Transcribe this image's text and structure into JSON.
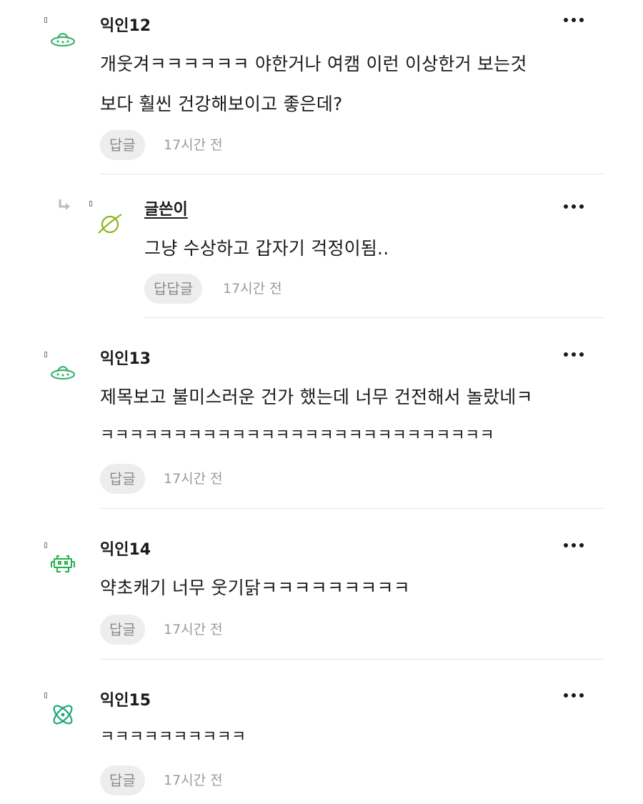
{
  "comments": [
    {
      "author": "익인12",
      "lines": [
        "개웃겨ㅋㅋㅋㅋㅋㅋ 야한거나 여캠 이런 이상한거 보는것",
        "보다 훨씬 건강해보이고 좋은데?"
      ],
      "reply_label": "답글",
      "time": "17시간 전",
      "avatar_icon": "ufo-icon",
      "avatar_color": "#3cb371"
    },
    {
      "author": "글쓴이",
      "lines": [
        "그냥 수상하고 갑자기 걱정이됨.."
      ],
      "reply_label": "답답글",
      "time": "17시간 전",
      "avatar_icon": "planet-icon",
      "avatar_color": "#8bb31d",
      "is_reply": true
    },
    {
      "author": "익인13",
      "lines": [
        "제목보고 불미스러운 건가 했는데 너무 건전해서 놀랐네ㅋ",
        "ㅋㅋㅋㅋㅋㅋㅋㅋㅋㅋㅋㅋㅋㅋㅋㅋㅋㅋㅋㅋㅋㅋㅋㅋㅋㅋㅋ"
      ],
      "reply_label": "답글",
      "time": "17시간 전",
      "avatar_icon": "ufo-icon",
      "avatar_color": "#3cb371"
    },
    {
      "author": "익인14",
      "lines": [
        "약초캐기 너무 웃기닭ㅋㅋㅋㅋㅋㅋㅋㅋㅋ"
      ],
      "reply_label": "답글",
      "time": "17시간 전",
      "avatar_icon": "space-invader-icon",
      "avatar_color": "#22b14c"
    },
    {
      "author": "익인15",
      "lines": [
        "ㅋㅋㅋㅋㅋㅋㅋㅋㅋㅋ"
      ],
      "reply_label": "답글",
      "time": "17시간 전",
      "avatar_icon": "atom-icon",
      "avatar_color": "#20a77a"
    }
  ],
  "icons": {
    "more": "more-options-icon",
    "reply_indicator": "reply-arrow-icon"
  }
}
